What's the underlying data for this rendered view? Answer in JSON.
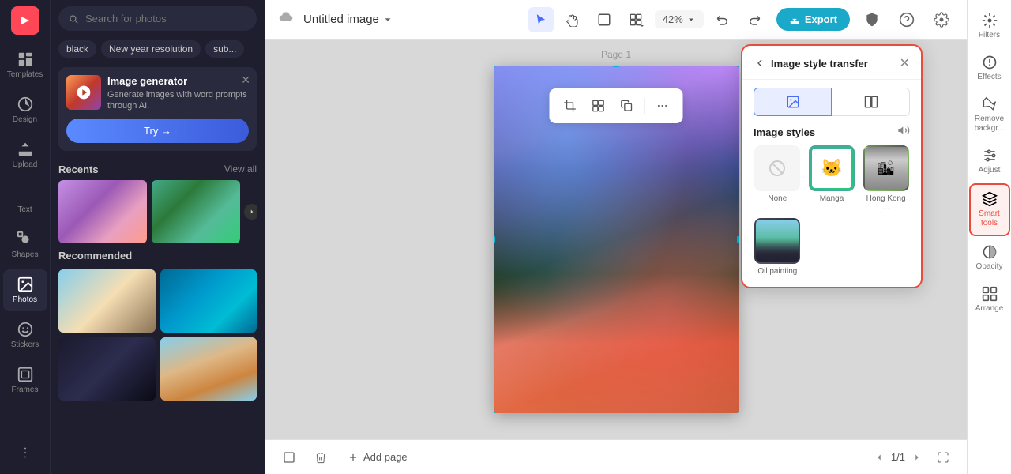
{
  "app": {
    "logo": "✕"
  },
  "left_sidebar": {
    "items": [
      {
        "id": "templates",
        "label": "Templates",
        "active": false
      },
      {
        "id": "design",
        "label": "Design",
        "active": false
      },
      {
        "id": "upload",
        "label": "Upload",
        "active": false
      },
      {
        "id": "text",
        "label": "Text",
        "active": false
      },
      {
        "id": "shapes",
        "label": "Shapes",
        "active": false
      },
      {
        "id": "photos",
        "label": "Photos",
        "active": true
      },
      {
        "id": "stickers",
        "label": "Stickers",
        "active": false
      },
      {
        "id": "frames",
        "label": "Frames",
        "active": false
      }
    ]
  },
  "photos_panel": {
    "search_placeholder": "Search for photos",
    "tags": [
      "black",
      "New year resolution",
      "sub..."
    ],
    "image_generator": {
      "title": "Image generator",
      "description": "Generate images with word prompts through AI.",
      "try_label": "Try →"
    },
    "recents": {
      "title": "Recents",
      "view_all": "View all"
    },
    "recommended": {
      "title": "Recommended"
    }
  },
  "top_toolbar": {
    "doc_title": "Untitled image",
    "zoom_level": "42%",
    "export_label": "Export",
    "undo_tooltip": "Undo",
    "redo_tooltip": "Redo"
  },
  "canvas": {
    "page_label": "Page 1"
  },
  "bottom_bar": {
    "add_page_label": "Add page",
    "page_indicator": "1/1"
  },
  "ist_panel": {
    "title": "Image style transfer",
    "styles_title": "Image styles",
    "styles": [
      {
        "id": "none",
        "label": "None"
      },
      {
        "id": "manga",
        "label": "Manga"
      },
      {
        "id": "hong_kong",
        "label": "Hong Kong ..."
      },
      {
        "id": "oil_painting",
        "label": "Oil painting"
      }
    ]
  },
  "right_sidebar": {
    "tools": [
      {
        "id": "filters",
        "label": "Filters",
        "active": false
      },
      {
        "id": "effects",
        "label": "Effects",
        "active": false
      },
      {
        "id": "remove_bg",
        "label": "Remove backgr...",
        "active": false
      },
      {
        "id": "adjust",
        "label": "Adjust",
        "active": false
      },
      {
        "id": "smart_tools",
        "label": "Smart tools",
        "active": true
      },
      {
        "id": "opacity",
        "label": "Opacity",
        "active": false
      },
      {
        "id": "arrange",
        "label": "Arrange",
        "active": false
      }
    ]
  }
}
